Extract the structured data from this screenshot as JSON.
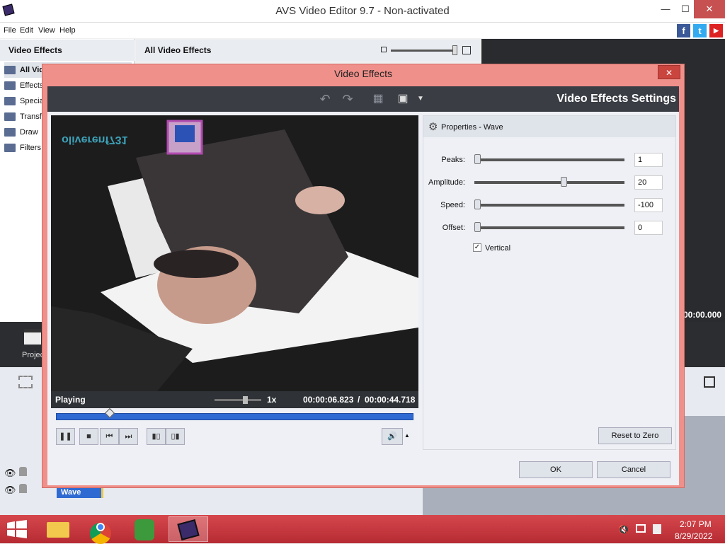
{
  "app": {
    "title": "AVS Video Editor 9.7 - Non-activated"
  },
  "window_controls": {
    "minimize": "—",
    "maximize": "☐",
    "close": "✕"
  },
  "menu": [
    "File",
    "Edit",
    "View",
    "Help"
  ],
  "social": {
    "facebook": "f",
    "twitter": "t",
    "youtube": "▶"
  },
  "left_panel": {
    "title": "Video Effects",
    "items": [
      "All Vid",
      "Effects",
      "Specia",
      "Transf",
      "Draw",
      "Filters"
    ]
  },
  "effects_panel": {
    "title": "All Video Effects"
  },
  "right_time": "00:00.000",
  "project_label": "Projec",
  "timeline": {
    "clip_label": "Wave"
  },
  "dialog": {
    "title": "Video Effects",
    "close": "✕",
    "settings_title": "Video Effects Settings",
    "player": {
      "status": "Playing",
      "speed": "1x",
      "current_time": "00:00:06.823",
      "separator": "/",
      "total_time": "00:00:44.718",
      "progress": 0.15
    },
    "properties": {
      "title": "Properties - Wave",
      "params": [
        {
          "label": "Peaks:",
          "value": "1",
          "level": 0.0
        },
        {
          "label": "Amplitude:",
          "value": "20",
          "level": 0.6
        },
        {
          "label": "Speed:",
          "value": "-100",
          "level": 0.0
        },
        {
          "label": "Offset:",
          "value": "0",
          "level": 0.0
        }
      ],
      "vertical": {
        "label": "Vertical",
        "checked": true
      },
      "reset_label": "Reset to Zero"
    },
    "ok_label": "OK",
    "cancel_label": "Cancel"
  },
  "taskbar": {
    "time": "2:07 PM",
    "date": "8/29/2022"
  },
  "colors": {
    "accent": "#2f6ad3",
    "dialog_frame": "#f0908a",
    "taskbar": "#c2303a"
  }
}
